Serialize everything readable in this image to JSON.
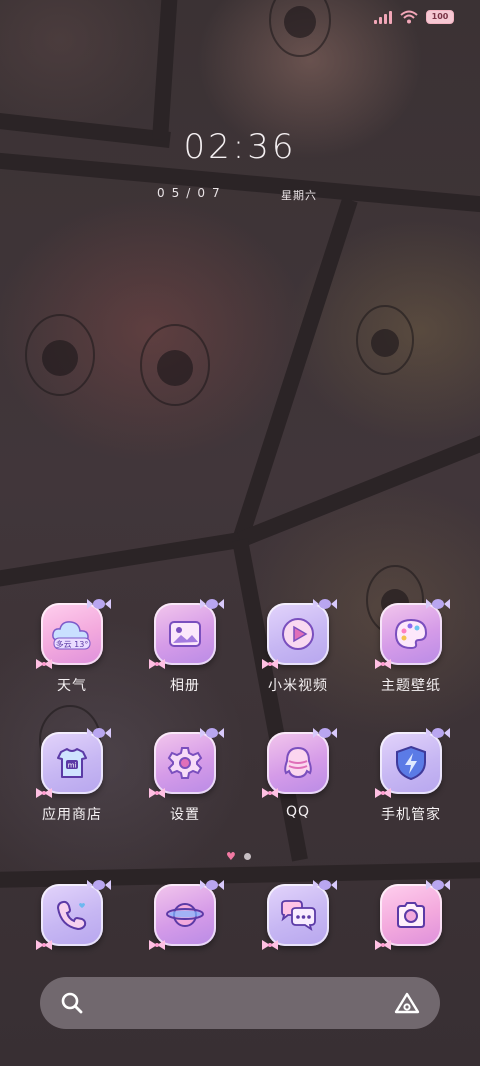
{
  "status_bar": {
    "battery": "100"
  },
  "lockscreen": {
    "time": "02:36",
    "date": "05/07",
    "weekday": "星期六"
  },
  "apps": [
    {
      "label": "天气",
      "icon": "weather-icon",
      "badge": "多云 13°"
    },
    {
      "label": "相册",
      "icon": "gallery-icon"
    },
    {
      "label": "小米视频",
      "icon": "video-icon"
    },
    {
      "label": "主题壁纸",
      "icon": "palette-icon"
    },
    {
      "label": "应用商店",
      "icon": "app-store-icon",
      "badge": "mi"
    },
    {
      "label": "设置",
      "icon": "gear-icon"
    },
    {
      "label": "QQ",
      "icon": "qq-penguin-icon"
    },
    {
      "label": "手机管家",
      "icon": "security-shield-icon"
    }
  ],
  "dock": [
    {
      "icon": "phone-icon"
    },
    {
      "icon": "browser-planet-icon"
    },
    {
      "icon": "messages-icon"
    },
    {
      "icon": "camera-icon"
    }
  ],
  "search": {
    "search_icon": "search-icon",
    "assistant_icon": "assistant-icon"
  },
  "colors": {
    "accent_pink": "#f27aa3",
    "icon_purple": "#c9a1ea"
  }
}
